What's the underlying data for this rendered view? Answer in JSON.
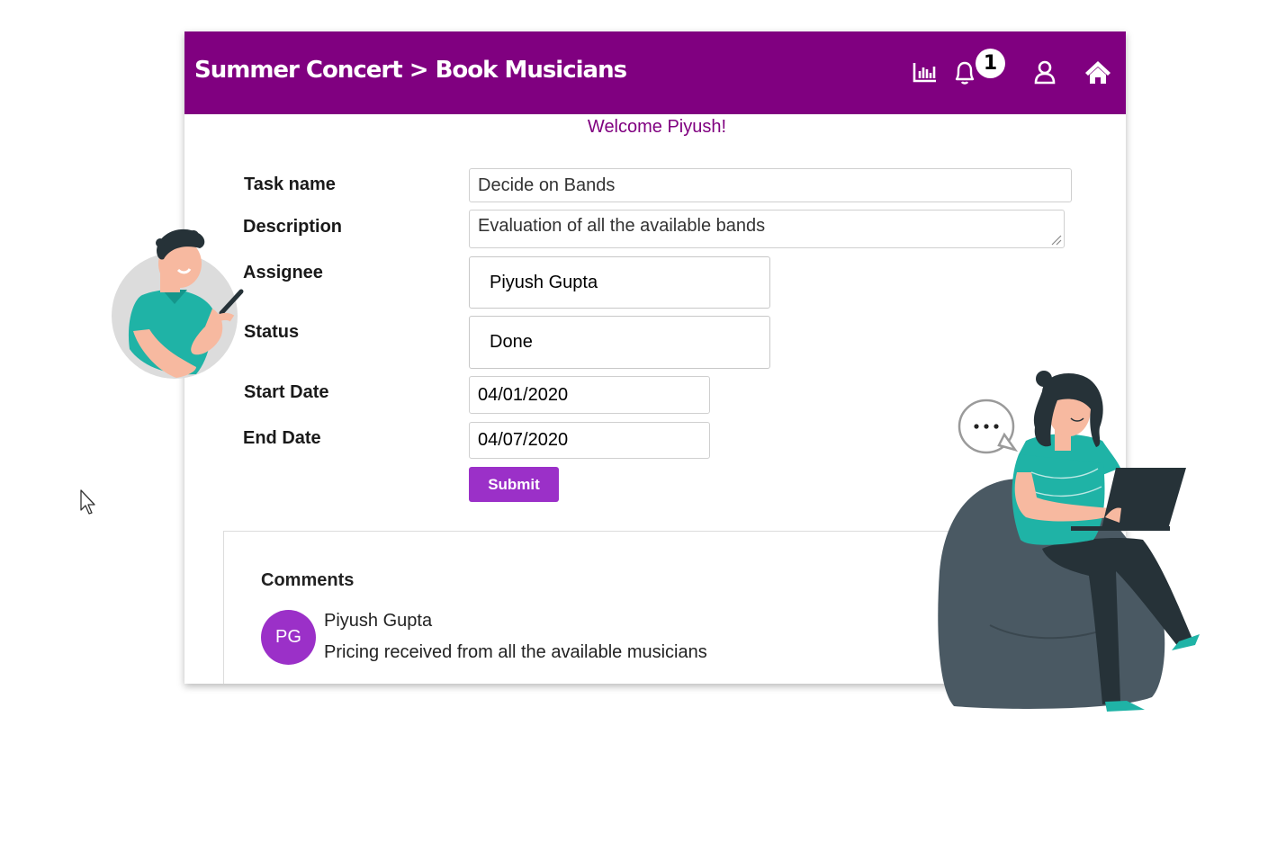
{
  "header": {
    "title": "Summer Concert > Book Musicians",
    "notification_count": "1",
    "icons": [
      "bar-chart-icon",
      "bell-icon",
      "user-icon",
      "home-icon"
    ],
    "background_color": "#800080"
  },
  "welcome_text": "Welcome Piyush!",
  "form": {
    "task_name_label": "Task name",
    "task_name_value": "Decide on Bands",
    "description_label": "Description",
    "description_value": "Evaluation of all the available bands",
    "assignee_label": "Assignee",
    "assignee_value": "Piyush Gupta",
    "status_label": "Status",
    "status_value": "Done",
    "start_date_label": "Start Date",
    "start_date_value": "04/01/2020",
    "end_date_label": "End Date",
    "end_date_value": "04/07/2020",
    "submit_label": "Submit"
  },
  "comments": {
    "title": "Comments",
    "items": [
      {
        "initials": "PG",
        "author": "Piyush Gupta",
        "text": "Pricing received from all the available musicians"
      }
    ]
  },
  "colors": {
    "brand_purple": "#800080",
    "button_purple": "#9b30c8",
    "teal": "#1fb3a6",
    "chair": "#4a5963"
  }
}
